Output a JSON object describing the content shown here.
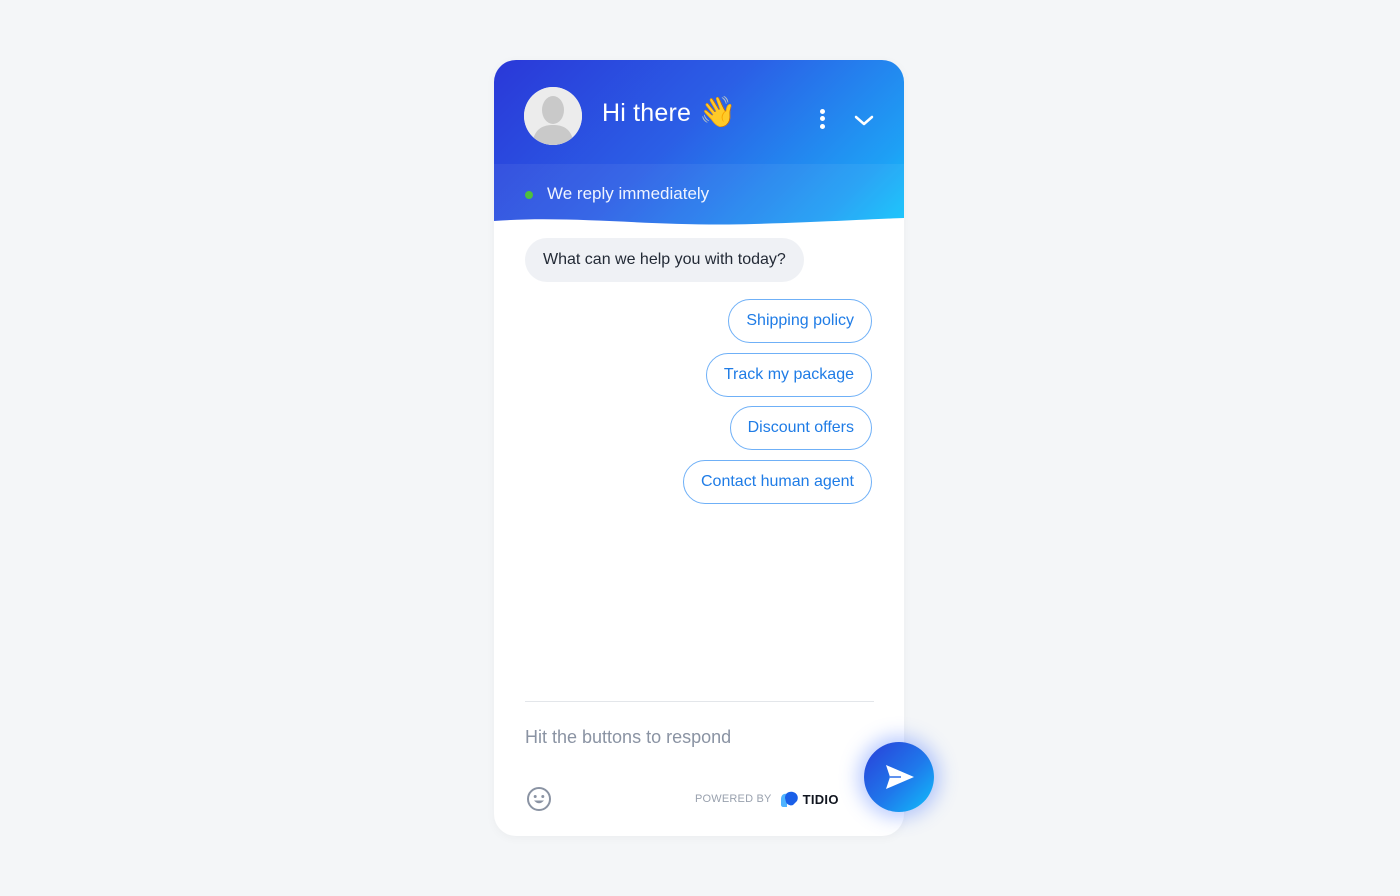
{
  "header": {
    "title": "Hi there",
    "title_emoji": "👋",
    "status_text": "We reply immediately",
    "status_color": "#4ec03d",
    "menu_icon": "more-vertical-icon",
    "collapse_icon": "chevron-down-icon",
    "avatar_icon": "user-avatar-icon"
  },
  "messages": {
    "bot_message": "What can we help you with today?",
    "options": [
      {
        "label": "Shipping policy"
      },
      {
        "label": "Track my package"
      },
      {
        "label": "Discount offers"
      },
      {
        "label": "Contact human agent"
      }
    ]
  },
  "composer": {
    "placeholder": "Hit the buttons to respond",
    "value": "",
    "emoji_icon": "smiley-icon",
    "send_icon": "send-icon"
  },
  "footer": {
    "powered_by": "POWERED BY",
    "brand": "TIDIO"
  },
  "colors": {
    "accent": "#1f7ce6",
    "header_start": "#2a38d8",
    "header_end": "#10c6fc"
  }
}
